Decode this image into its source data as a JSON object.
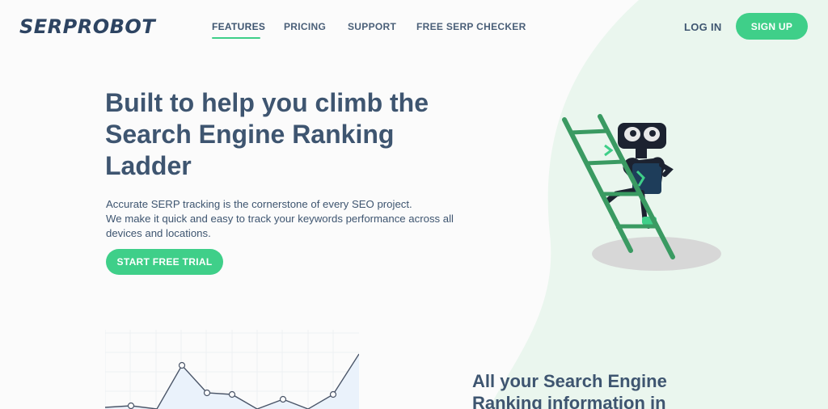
{
  "brand": {
    "logo_text": "SERPROBOT"
  },
  "nav": {
    "links": [
      "FEATURES",
      "PRICING",
      "SUPPORT",
      "FREE SERP CHECKER"
    ],
    "active": "FEATURES",
    "login_label": "LOG IN",
    "signup_label": "SIGN UP"
  },
  "hero": {
    "title_lines": [
      "Built to help you climb the",
      "Search Engine Ranking",
      "Ladder"
    ],
    "subtitle_lines": [
      "Accurate SERP tracking is the cornerstone of every SEO project.",
      "We make it quick and easy to track your keywords performance across all",
      "devices and locations."
    ],
    "cta_label": "START FREE TRIAL"
  },
  "section": {
    "title_lines": [
      "All your Search Engine",
      "Ranking information in"
    ]
  },
  "colors": {
    "accent": "#3fcf89",
    "text": "#3e5570",
    "background_blob": "#eaf6ee"
  },
  "icons": [
    "robot-on-ladder-illustration",
    "line-chart-illustration"
  ]
}
